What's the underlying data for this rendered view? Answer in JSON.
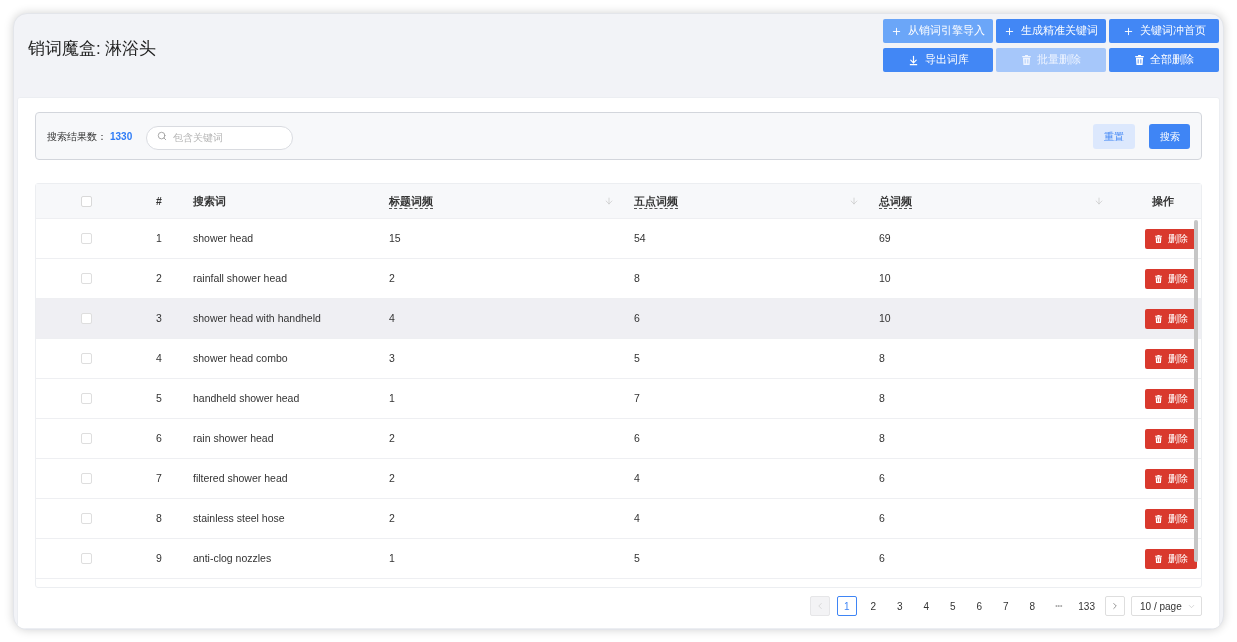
{
  "header": {
    "title": "销词魔盒: 淋浴头",
    "buttons": [
      {
        "label": "从销词引擎导入",
        "kind": "add",
        "hovered": true,
        "disabled": false
      },
      {
        "label": "生成精准关键词",
        "kind": "add",
        "hovered": false,
        "disabled": false
      },
      {
        "label": "关键词冲首页",
        "kind": "add",
        "hovered": false,
        "disabled": false
      },
      {
        "label": "导出词库",
        "kind": "export",
        "hovered": false,
        "disabled": false
      },
      {
        "label": "批量删除",
        "kind": "delete",
        "hovered": false,
        "disabled": true
      },
      {
        "label": "全部删除",
        "kind": "delete",
        "hovered": false,
        "disabled": false
      }
    ]
  },
  "search_bar": {
    "result_label": "搜索结果数：",
    "result_count": "1330",
    "search_field": {
      "placeholder": "包含关键词"
    },
    "buttons": [
      {
        "label": "重置",
        "kind": "secondary"
      },
      {
        "label": "搜索",
        "kind": "primary"
      }
    ]
  },
  "table": {
    "select_all": {
      "checked": false
    },
    "columns": [
      {
        "label": "#",
        "kind": "index",
        "sortable": false,
        "has_hint": false
      },
      {
        "label": "搜索词",
        "kind": "text",
        "sortable": false,
        "has_hint": false
      },
      {
        "label": "标题词频",
        "kind": "metric",
        "sortable": true,
        "has_hint": true
      },
      {
        "label": "五点词频",
        "kind": "metric",
        "sortable": true,
        "has_hint": true
      },
      {
        "label": "总词频",
        "kind": "metric",
        "sortable": true,
        "has_hint": true
      },
      {
        "label": "操作",
        "kind": "action",
        "sortable": false,
        "has_hint": false
      }
    ],
    "rows": [
      {
        "checked": false,
        "highlighted": false,
        "cells": [
          "1",
          "shower head",
          "15",
          "54",
          "69"
        ],
        "action": "删除"
      },
      {
        "checked": false,
        "highlighted": false,
        "cells": [
          "2",
          "rainfall shower head",
          "2",
          "8",
          "10"
        ],
        "action": "删除"
      },
      {
        "checked": false,
        "highlighted": true,
        "cells": [
          "3",
          "shower head with handheld",
          "4",
          "6",
          "10"
        ],
        "action": "删除"
      },
      {
        "checked": false,
        "highlighted": false,
        "cells": [
          "4",
          "shower head combo",
          "3",
          "5",
          "8"
        ],
        "action": "删除"
      },
      {
        "checked": false,
        "highlighted": false,
        "cells": [
          "5",
          "handheld shower head",
          "1",
          "7",
          "8"
        ],
        "action": "删除"
      },
      {
        "checked": false,
        "highlighted": false,
        "cells": [
          "6",
          "rain shower head",
          "2",
          "6",
          "8"
        ],
        "action": "删除"
      },
      {
        "checked": false,
        "highlighted": false,
        "cells": [
          "7",
          "filtered shower head",
          "2",
          "4",
          "6"
        ],
        "action": "删除"
      },
      {
        "checked": false,
        "highlighted": false,
        "cells": [
          "8",
          "stainless steel hose",
          "2",
          "4",
          "6"
        ],
        "action": "删除"
      },
      {
        "checked": false,
        "highlighted": false,
        "cells": [
          "9",
          "anti-clog nozzles",
          "1",
          "5",
          "6"
        ],
        "action": "删除"
      }
    ]
  },
  "pagination": {
    "prev": {
      "disabled": true
    },
    "pages": [
      {
        "label": "1",
        "kind": "page",
        "selected": true
      },
      {
        "label": "2",
        "kind": "page",
        "selected": false
      },
      {
        "label": "3",
        "kind": "page",
        "selected": false
      },
      {
        "label": "4",
        "kind": "page",
        "selected": false
      },
      {
        "label": "5",
        "kind": "page",
        "selected": false
      },
      {
        "label": "6",
        "kind": "page",
        "selected": false
      },
      {
        "label": "7",
        "kind": "page",
        "selected": false
      },
      {
        "label": "8",
        "kind": "page",
        "selected": false
      },
      {
        "label": "•••",
        "kind": "ellipsis",
        "selected": false
      },
      {
        "label": "133",
        "kind": "page",
        "selected": false
      }
    ],
    "next": {
      "disabled": false
    },
    "page_size": "10 / page"
  }
}
